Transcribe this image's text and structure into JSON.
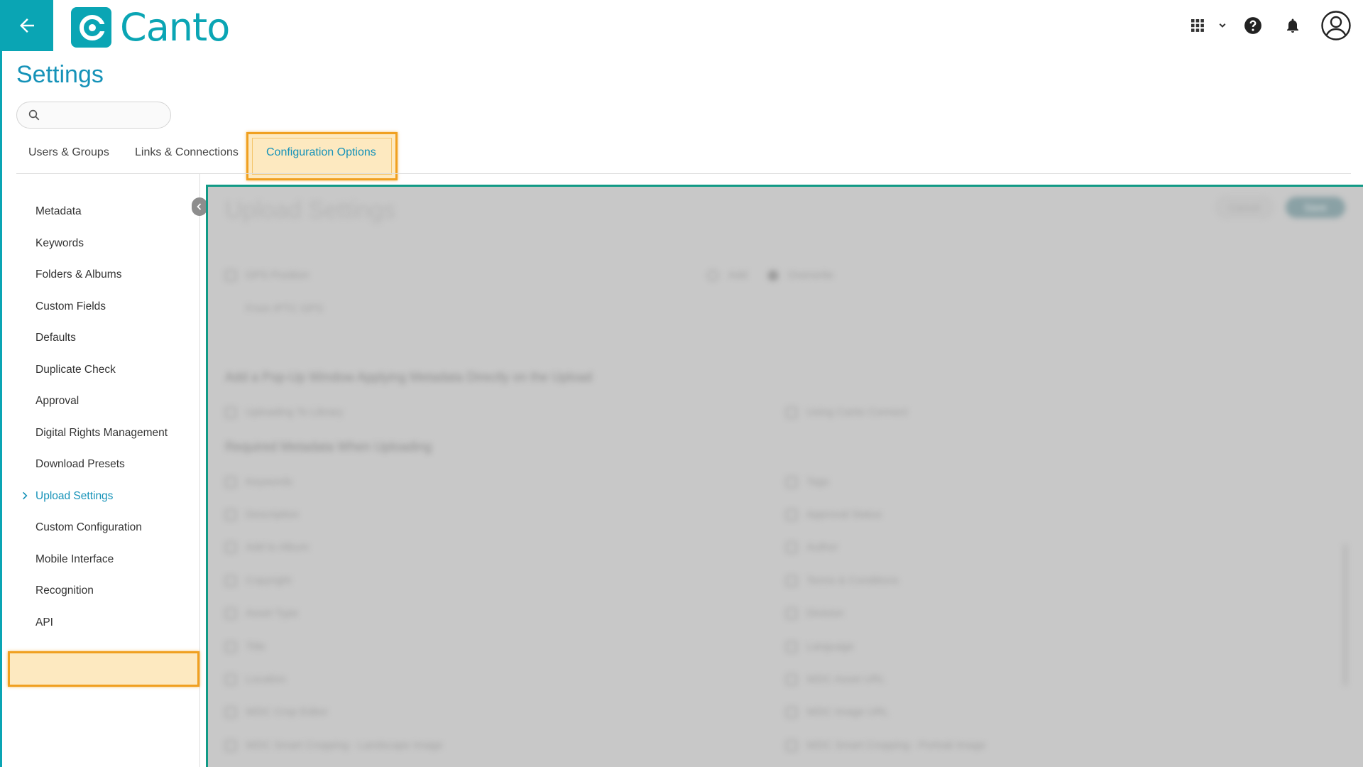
{
  "header": {
    "logo_text": "Canto",
    "apps_icon": "grid-icon",
    "help_icon": "help-icon",
    "bell_icon": "bell-icon",
    "avatar_icon": "avatar-icon",
    "accent_color": "#0aa5b4"
  },
  "page": {
    "title": "Settings",
    "search_placeholder": ""
  },
  "tabs": [
    {
      "label": "Users & Groups",
      "active": false
    },
    {
      "label": "Links & Connections",
      "active": false
    },
    {
      "label": "Configuration Options",
      "active": true
    }
  ],
  "sidebar": {
    "items": [
      {
        "label": "Metadata"
      },
      {
        "label": "Keywords"
      },
      {
        "label": "Folders & Albums"
      },
      {
        "label": "Custom Fields"
      },
      {
        "label": "Defaults"
      },
      {
        "label": "Duplicate Check"
      },
      {
        "label": "Approval"
      },
      {
        "label": "Digital Rights Management"
      },
      {
        "label": "Download Presets"
      },
      {
        "label": "Upload Settings"
      },
      {
        "label": "Custom Configuration"
      },
      {
        "label": "Mobile Interface"
      },
      {
        "label": "Recognition"
      },
      {
        "label": "API"
      }
    ],
    "active_index": 9
  },
  "content": {
    "title": "Upload Settings",
    "cancel_label": "Cancel",
    "save_label": "Save",
    "gps_label": "GPS Position",
    "gps_sub": "From IPTC GPS",
    "radio_add": "Add",
    "radio_overwrite": "Overwrite",
    "popup_heading": "Add a Pop-Up Window Applying Metadata Directly on the Upload",
    "popup_opt1": "Uploading To Library",
    "popup_opt2": "Using Canto Connect",
    "required_heading": "Required Metadata When Uploading",
    "required_left": [
      "Keywords",
      "Description",
      "Add to Album",
      "Copyright",
      "Asset Type",
      "Title",
      "Location",
      "WDC Crop Editor",
      "WDC Smart Cropping - Landscape Image"
    ],
    "required_right": [
      "Tags",
      "Approval Status",
      "Author",
      "Terms & Conditions",
      "Division",
      "Language",
      "WDC Asset URL",
      "WDC Image URL",
      "WDC Smart Cropping - Portrait Image"
    ]
  }
}
